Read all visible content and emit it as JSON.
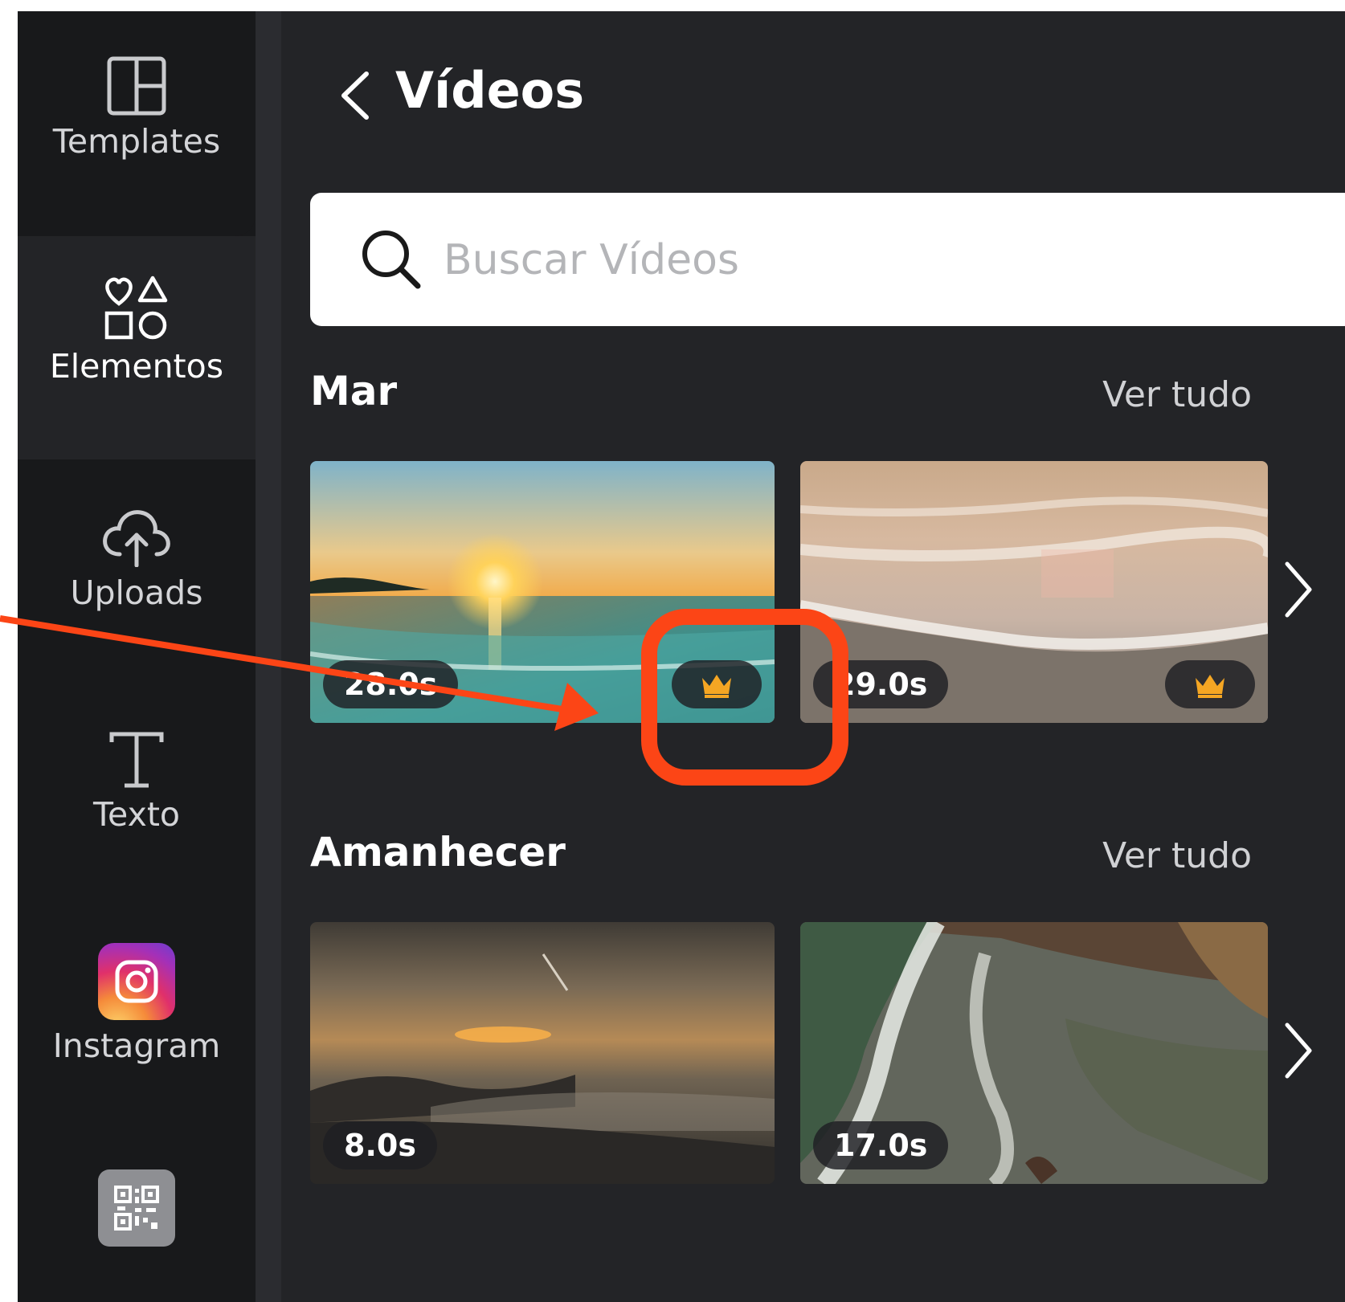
{
  "sidebar": {
    "items": [
      {
        "label": "Templates",
        "icon": "layout-icon"
      },
      {
        "label": "Elementos",
        "icon": "shapes-icon"
      },
      {
        "label": "Uploads",
        "icon": "cloud-upload-icon"
      },
      {
        "label": "Texto",
        "icon": "text-icon"
      },
      {
        "label": "Instagram",
        "icon": "instagram-icon"
      },
      {
        "label": "",
        "icon": "qr-code-icon"
      }
    ]
  },
  "panel": {
    "title": "Vídeos",
    "search": {
      "placeholder": "Buscar Vídeos"
    },
    "sections": [
      {
        "title": "Mar",
        "see_all": "Ver tudo",
        "videos": [
          {
            "duration": "28.0s",
            "premium": true,
            "scene": "sunset beach"
          },
          {
            "duration": "29.0s",
            "premium": true,
            "scene": "waves on sand"
          }
        ]
      },
      {
        "title": "Amanhecer",
        "see_all": "Ver tudo",
        "videos": [
          {
            "duration": "8.0s",
            "premium": false,
            "scene": "dawn over mountains"
          },
          {
            "duration": "17.0s",
            "premium": false,
            "scene": "aerial shoreline"
          }
        ]
      }
    ]
  },
  "colors": {
    "sidebar_bg": "#18191b",
    "panel_bg": "#232427",
    "premium_crown": "#f5a623",
    "annotation": "#fc4516"
  }
}
